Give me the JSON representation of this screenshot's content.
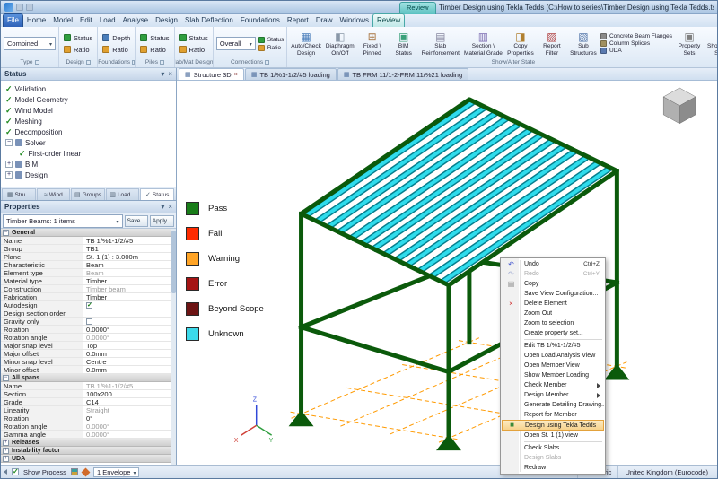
{
  "window": {
    "title": "Timber Design using Tekla Tedds (C:\\How to series\\Timber Design using Tekla Tedds.tsmd) - Tekla Structural Des...",
    "contextual_tab_label": "Review"
  },
  "ribbon": {
    "tabs": [
      {
        "label": "File",
        "file": true
      },
      {
        "label": "Home"
      },
      {
        "label": "Model"
      },
      {
        "label": "Edit"
      },
      {
        "label": "Load"
      },
      {
        "label": "Analyse"
      },
      {
        "label": "Design"
      },
      {
        "label": "Slab Deflection"
      },
      {
        "label": "Foundations"
      },
      {
        "label": "Report"
      },
      {
        "label": "Draw"
      },
      {
        "label": "Windows"
      },
      {
        "label": "Review",
        "active": true
      }
    ],
    "type_group": {
      "label": "Type",
      "dropdown": "Combined"
    },
    "small_groups": [
      {
        "label": "Design",
        "b1": "Status",
        "b1_color": "#2f9e3f",
        "b2": "Ratio",
        "b2_color": "#e0a030"
      },
      {
        "label": "Foundations",
        "b1": "Depth",
        "b1_color": "#4a7ebb",
        "b2": "Ratio",
        "b2_color": "#e0a030"
      },
      {
        "label": "Piles",
        "b1": "Status",
        "b1_color": "#2f9e3f",
        "b2": "Ratio",
        "b2_color": "#e0a030"
      },
      {
        "label": "Slab/Mat Design",
        "b1": "Status",
        "b1_color": "#2f9e3f",
        "b2": "Ratio",
        "b2_color": "#e0a030"
      }
    ],
    "connections_group": {
      "label": "Connections",
      "dropdown": "Overall",
      "s1": "Status",
      "s1_color": "#2f9e3f",
      "s2": "Ratio",
      "s2_color": "#e0a030"
    },
    "state_group_label": "Show/Alter State",
    "big_buttons": [
      {
        "line1": "Auto/Check",
        "line2": "Design",
        "glyph": "▦",
        "color": "#4a7ebb"
      },
      {
        "line1": "Diaphragm",
        "line2": "On/Off",
        "glyph": "◧",
        "color": "#8a98a8"
      },
      {
        "line1": "Fixed \\",
        "line2": "Pinned",
        "glyph": "⊞",
        "color": "#aa7744"
      },
      {
        "line1": "BIM",
        "line2": "Status",
        "glyph": "▣",
        "color": "#3aa07a"
      },
      {
        "line1": "Slab",
        "line2": "Reinforcement",
        "glyph": "▤",
        "color": "#8888a0"
      },
      {
        "line1": "Section \\",
        "line2": "Material Grade",
        "glyph": "▥",
        "color": "#7a6ab0"
      },
      {
        "line1": "Copy",
        "line2": "Properties",
        "glyph": "◨",
        "color": "#b08030"
      },
      {
        "line1": "Report",
        "line2": "Filter",
        "glyph": "▨",
        "color": "#b04040"
      },
      {
        "line1": "Sub",
        "line2": "Structures",
        "glyph": "▧",
        "color": "#5577aa"
      }
    ],
    "stack_buttons": [
      {
        "label": "Concrete Beam Flanges",
        "color": "#8a8a8a"
      },
      {
        "label": "Column Splices",
        "color": "#a09060"
      },
      {
        "label": "UDA",
        "color": "#5a7ab0"
      }
    ],
    "big_buttons2": [
      {
        "line1": "Property",
        "line2": "Sets",
        "glyph": "▣",
        "color": "#808080"
      },
      {
        "line1": "Show/Alter",
        "line2": "State",
        "glyph": "▦",
        "color": "#4a7ebb"
      }
    ]
  },
  "status_panel": {
    "title": "Status",
    "tree": [
      {
        "label": "Validation",
        "check": true
      },
      {
        "label": "Model Geometry",
        "check": true
      },
      {
        "label": "Wind Model",
        "check": true
      },
      {
        "label": "Meshing",
        "check": true
      },
      {
        "label": "Decomposition",
        "check": true
      },
      {
        "label": "Solver",
        "expMinus": true,
        "icon": true
      },
      {
        "label": "First-order linear",
        "check": true,
        "child": true
      },
      {
        "label": "BIM",
        "expPlus": true,
        "icon": true
      },
      {
        "label": "Design",
        "expPlus": true,
        "icon": true
      }
    ],
    "tabs": [
      {
        "label": "Stru...",
        "glyph": "▦"
      },
      {
        "label": "Wind",
        "glyph": "≈"
      },
      {
        "label": "Groups",
        "glyph": "▤"
      },
      {
        "label": "Load...",
        "glyph": "▥"
      },
      {
        "label": "Status",
        "glyph": "✓",
        "active": true
      }
    ]
  },
  "properties": {
    "title": "Properties",
    "selector": "Timber Beams: 1 items",
    "save_label": "Save...",
    "apply_label": "Apply...",
    "section_general": "General",
    "general_rows": [
      {
        "label": "Name",
        "value": "TB 1/%1-1/2/#5"
      },
      {
        "label": "Group",
        "value": "TB1"
      },
      {
        "label": "Plane",
        "value": "St. 1 (1) : 3.000m"
      },
      {
        "label": "Characteristic",
        "value": "Beam"
      },
      {
        "label": "Element type",
        "value": "Beam",
        "dim": true
      },
      {
        "label": "Material type",
        "value": "Timber"
      },
      {
        "label": "Construction",
        "value": "Timber beam",
        "dim": true
      },
      {
        "label": "Fabrication",
        "value": "Timber"
      },
      {
        "label": "Autodesign",
        "value": "",
        "checkbox": true,
        "checked": true
      },
      {
        "label": "Design section order",
        "value": ""
      },
      {
        "label": "Gravity only",
        "value": "",
        "checkbox": true
      },
      {
        "label": "Rotation",
        "value": "0.0000°"
      },
      {
        "label": "Rotation angle",
        "value": "0.0000°",
        "dim": true
      },
      {
        "label": "Major snap level",
        "value": "Top"
      },
      {
        "label": "Major offset",
        "value": "0.0mm"
      },
      {
        "label": "Minor snap level",
        "value": "Centre"
      },
      {
        "label": "Minor offset",
        "value": "0.0mm"
      }
    ],
    "section_allspans": "All spans",
    "allspans_rows": [
      {
        "label": "Name",
        "value": "TB 1/%1-1/2/#5",
        "dim": true
      },
      {
        "label": "Section",
        "value": "100x200"
      },
      {
        "label": "Grade",
        "value": "C14"
      },
      {
        "label": "Linearity",
        "value": "Straight",
        "dim": true
      },
      {
        "label": "Rotation",
        "value": "0°"
      },
      {
        "label": "Rotation angle",
        "value": "0.0000°",
        "dim": true
      },
      {
        "label": "Gamma angle",
        "value": "0.0000°",
        "dim": true
      }
    ],
    "collapsed_sections": [
      "Releases",
      "Instability factor",
      "UDA"
    ]
  },
  "viewport": {
    "tabs": [
      {
        "label": "Structure 3D",
        "glyph": "▦",
        "active": true,
        "closable": true
      },
      {
        "label": "TB 1/%1-1/2/#5 loading",
        "glyph": "▦"
      },
      {
        "label": "TB FRM 11/1-2-FRM 11/%21 loading",
        "glyph": "▦"
      }
    ],
    "legend": [
      {
        "label": "Pass",
        "color": "#197d19"
      },
      {
        "label": "Fail",
        "color": "#fe2b00"
      },
      {
        "label": "Warning",
        "color": "#ffa426"
      },
      {
        "label": "Error",
        "color": "#a51414"
      },
      {
        "label": "Beyond Scope",
        "color": "#6d1414"
      },
      {
        "label": "Unknown",
        "color": "#3cd9ea"
      }
    ],
    "axis": {
      "x": "X",
      "y": "Y",
      "z": "Z"
    }
  },
  "context_menu": {
    "items": [
      {
        "label": "Undo",
        "shortcut": "Ctrl+Z",
        "glyph": "↶",
        "glyph_color": "#4a5bd0"
      },
      {
        "label": "Redo",
        "shortcut": "Ctrl+Y",
        "glyph": "↷",
        "glyph_color": "#9aa6d0",
        "disabled": true
      },
      {
        "label": "Copy",
        "glyph": "▤",
        "glyph_color": "#8a8a8a"
      },
      {
        "label": "Save View Configuration..."
      },
      {
        "label": "Delete Element",
        "glyph": "×",
        "glyph_color": "#d03030"
      },
      {
        "label": "Zoom Out"
      },
      {
        "label": "Zoom to selection"
      },
      {
        "label": "Create property set..."
      },
      {
        "sep": true
      },
      {
        "label": "Edit TB 1/%1-1/2/#5"
      },
      {
        "label": "Open Load Analysis View"
      },
      {
        "label": "Open Member View"
      },
      {
        "label": "Show Member Loading"
      },
      {
        "label": "Check Member",
        "sub": true
      },
      {
        "label": "Design Member",
        "sub": true
      },
      {
        "label": "Generate Detailing Drawing..."
      },
      {
        "label": "Report for Member"
      },
      {
        "label": "Design using Tekla Tedds",
        "hl": true,
        "glyph": "■",
        "glyph_color": "#3a8a3a"
      },
      {
        "label": "Open St. 1 (1) view"
      },
      {
        "sep": true
      },
      {
        "label": "Check Slabs"
      },
      {
        "label": "Design Slabs",
        "disabled": true
      },
      {
        "label": "Redraw"
      }
    ]
  },
  "status_bar": {
    "show_process": "Show Process",
    "envelope": "1 Envelope",
    "units": "Metric",
    "region": "United Kingdom (Eurocode)"
  }
}
